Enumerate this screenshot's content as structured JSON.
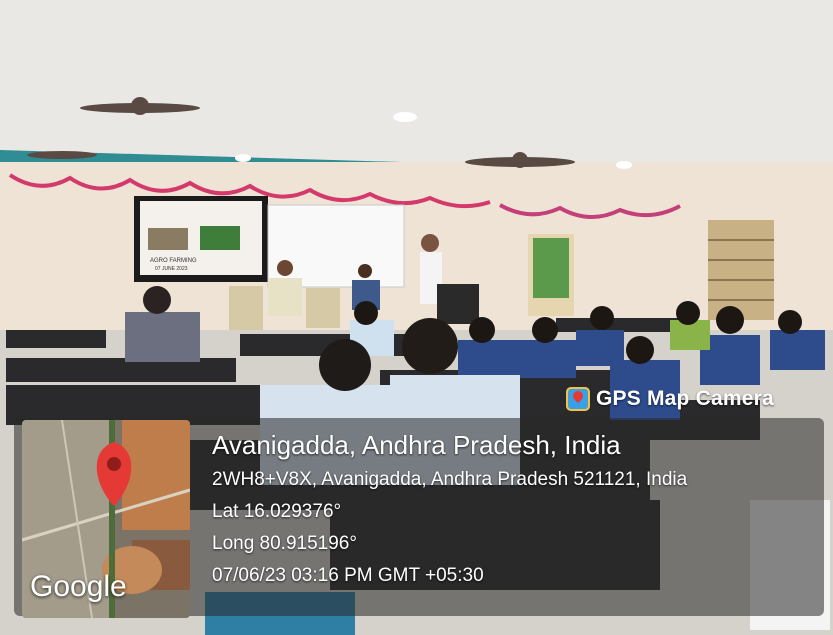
{
  "badge": {
    "label": "GPS Map Camera",
    "icon": "gps-map-camera-icon"
  },
  "location": {
    "place": "Avanigadda, Andhra Pradesh, India",
    "address": "2WH8+V8X, Avanigadda, Andhra Pradesh 521121, India",
    "lat": "Lat 16.029376°",
    "long": "Long 80.915196°",
    "datetime": "07/06/23 03:16 PM GMT +05:30"
  },
  "map": {
    "brand": "Google",
    "pin_color": "#e53935"
  },
  "screen": {
    "line1": "AGRO FARMING",
    "line2": "07 JUNE 2023"
  }
}
